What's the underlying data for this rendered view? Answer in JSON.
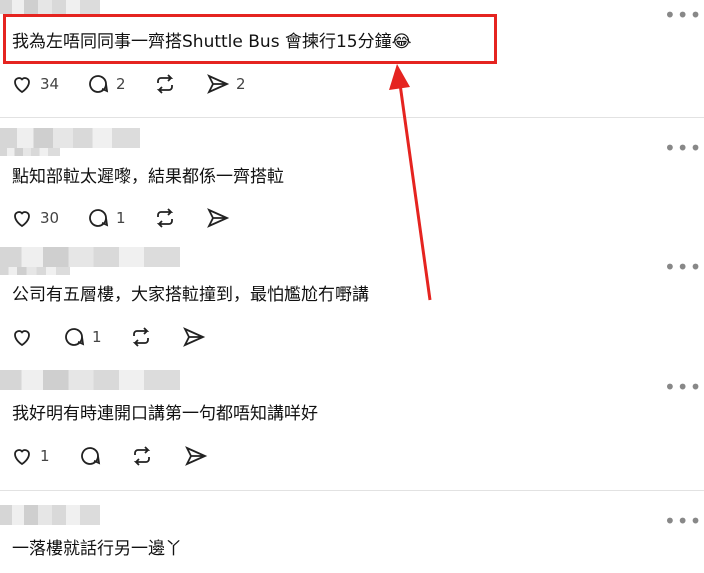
{
  "posts": [
    {
      "text": "我為左唔同同事一齊搭Shuttle Bus 會揀行15分鐘😂",
      "likes": "34",
      "replies": "2",
      "reposts": "",
      "shares": "2"
    },
    {
      "text": "點知部𨋢太遲嚟，結果都係一齊搭𨋢",
      "likes": "30",
      "replies": "1",
      "reposts": "",
      "shares": ""
    },
    {
      "text": "公司有五層樓，大家搭𨋢撞到，最怕尷尬冇嘢講",
      "likes": "",
      "replies": "1",
      "reposts": "",
      "shares": ""
    },
    {
      "text": "我好明有時連開口講第一句都唔知講咩好",
      "likes": "1",
      "replies": "",
      "reposts": "",
      "shares": ""
    },
    {
      "text": "一落樓就話行另一邊丫",
      "likes": "",
      "replies": "",
      "reposts": "",
      "shares": ""
    }
  ],
  "icons": {
    "more": "more-horizontal-icon",
    "like": "heart-icon",
    "reply": "comment-icon",
    "repost": "repost-icon",
    "share": "send-icon"
  },
  "colors": {
    "highlight": "#e52420",
    "arrow": "#e52420"
  }
}
